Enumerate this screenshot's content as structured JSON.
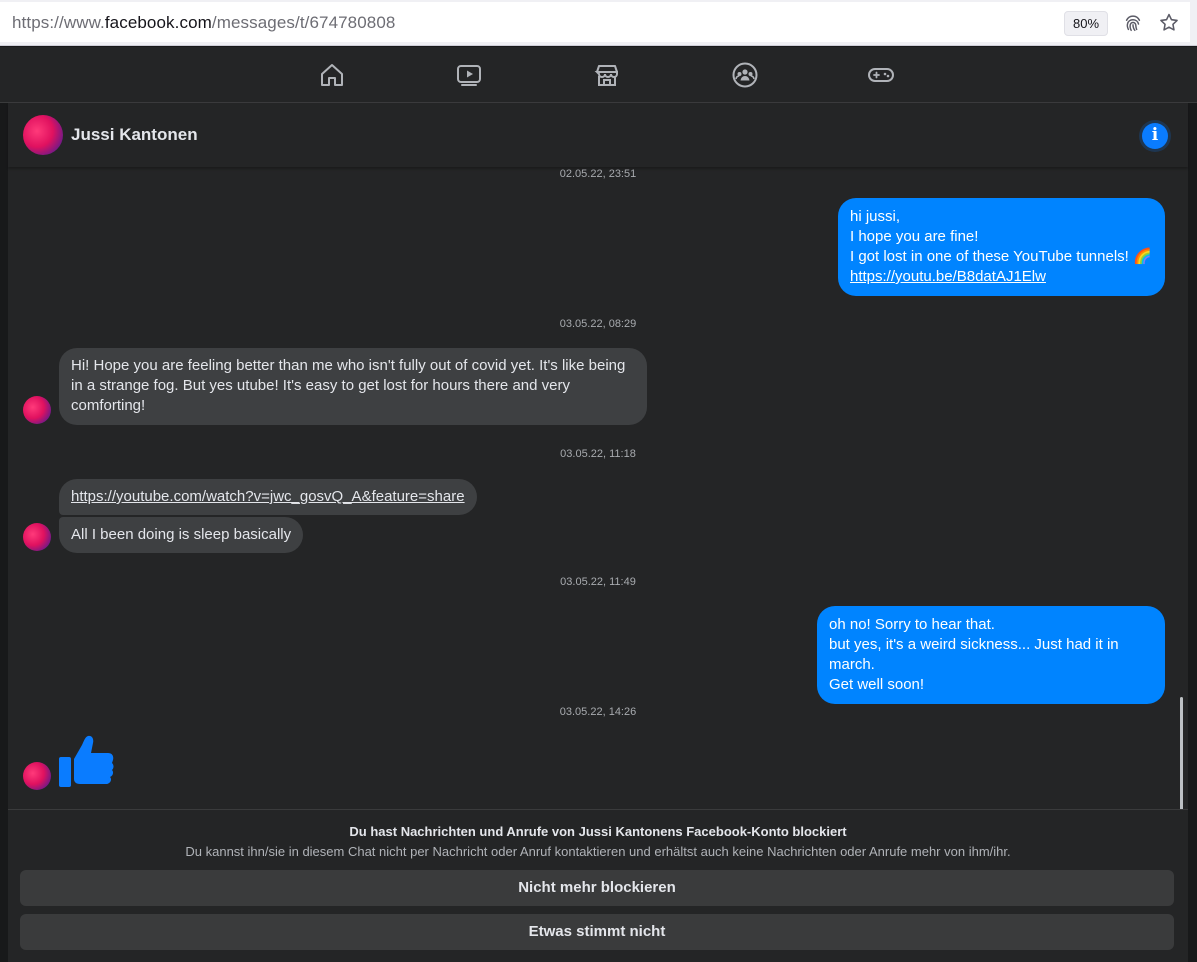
{
  "browser": {
    "url_prefix": "https://www.",
    "url_domain": "facebook.com",
    "url_path": "/messages/t/674780808",
    "zoom": "80%"
  },
  "nav": {
    "icons": [
      "home-icon",
      "watch-icon",
      "marketplace-icon",
      "groups-icon",
      "gaming-icon"
    ]
  },
  "header": {
    "contact_name": "Jussi Kantonen"
  },
  "messages": [
    {
      "type": "timestamp",
      "text": "02.05.22, 23:51"
    },
    {
      "type": "outgoing",
      "lines": [
        "hi jussi,",
        "I hope you are fine!",
        "I got lost in one of these YouTube tunnels! 🌈"
      ],
      "link": "https://youtu.be/B8datAJ1Elw"
    },
    {
      "type": "timestamp",
      "text": "03.05.22, 08:29"
    },
    {
      "type": "incoming",
      "text": "Hi! Hope you are feeling better than me who isn't fully out of covid yet. It's like being in a strange fog. But yes utube! It's easy to get lost for hours there and very comforting!"
    },
    {
      "type": "timestamp",
      "text": "03.05.22, 11:18"
    },
    {
      "type": "incoming",
      "link": "https://youtube.com/watch?v=jwc_gosvQ_A&feature=share"
    },
    {
      "type": "incoming",
      "text": "All I been doing is sleep basically"
    },
    {
      "type": "timestamp",
      "text": "03.05.22, 11:49"
    },
    {
      "type": "outgoing",
      "lines": [
        "oh no! Sorry to hear that.",
        "but yes, it's a weird sickness... Just had it in march.",
        "Get well soon!"
      ]
    },
    {
      "type": "timestamp",
      "text": "03.05.22, 14:26"
    },
    {
      "type": "incoming-like",
      "icon": "thumbs-up-icon"
    }
  ],
  "blocked": {
    "title": "Du hast Nachrichten und Anrufe von Jussi Kantonens Facebook-Konto blockiert",
    "subtitle": "Du kannst ihn/sie in diesem Chat nicht per Nachricht oder Anruf kontaktieren und erhältst auch keine Nachrichten oder Anrufe mehr von ihm/ihr.",
    "unblock_label": "Nicht mehr blockieren",
    "report_label": "Etwas stimmt nicht"
  },
  "colors": {
    "accent": "#0084ff",
    "background": "#242526",
    "incoming_bubble": "#3e4042"
  }
}
